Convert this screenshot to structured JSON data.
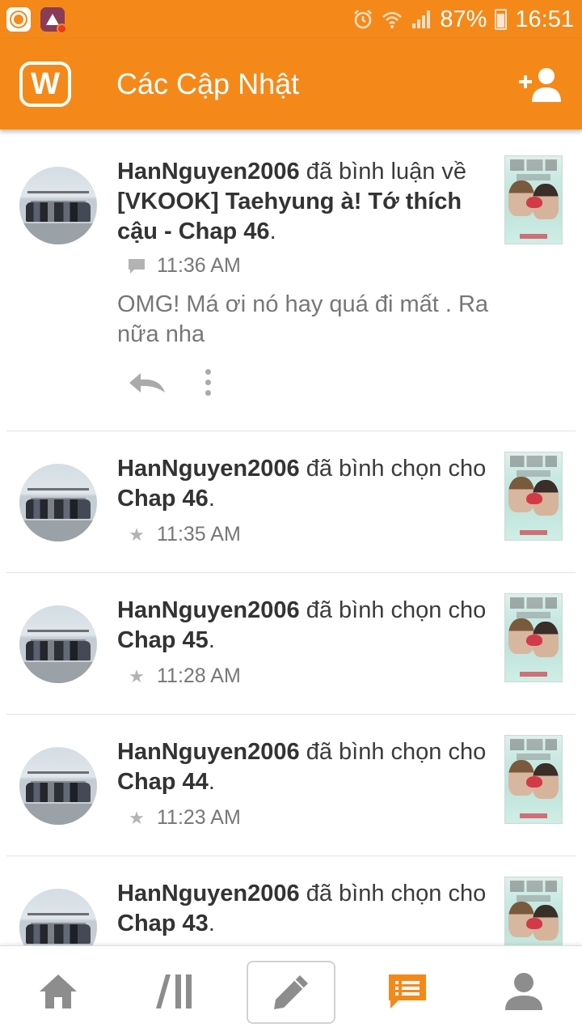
{
  "status_bar": {
    "battery": "87%",
    "time": "16:51"
  },
  "header": {
    "logo_letter": "W",
    "title": "Các Cập Nhật"
  },
  "feed": {
    "items": [
      {
        "user": "HanNguyen2006",
        "action": " đã bình luận về ",
        "target": "[VKOOK] Taehyung à! Tớ thích cậu - Chap 46",
        "end": ".",
        "icon": "comment-icon",
        "time": "11:36 AM",
        "comment": "OMG! Má ơi nó hay quá đi mất . Ra nữa nha"
      },
      {
        "user": "HanNguyen2006",
        "action": " đã bình chọn cho ",
        "target": "Chap 46",
        "end": ".",
        "icon": "star-icon",
        "time": "11:35 AM"
      },
      {
        "user": "HanNguyen2006",
        "action": " đã bình chọn cho ",
        "target": "Chap 45",
        "end": ".",
        "icon": "star-icon",
        "time": "11:28 AM"
      },
      {
        "user": "HanNguyen2006",
        "action": " đã bình chọn cho ",
        "target": "Chap 44",
        "end": ".",
        "icon": "star-icon",
        "time": "11:23 AM"
      },
      {
        "user": "HanNguyen2006",
        "action": " đã bình chọn cho ",
        "target": "Chap 43",
        "end": ".",
        "icon": "star-icon",
        "time": ""
      }
    ]
  },
  "bottom_nav": {
    "items": [
      "home-icon",
      "library-icon",
      "write-icon",
      "updates-icon",
      "profile-icon"
    ],
    "active": "updates-icon"
  },
  "colors": {
    "brand": "#f4891a",
    "active_nav": "#f4891a",
    "inactive_nav": "#8d8d8d"
  }
}
